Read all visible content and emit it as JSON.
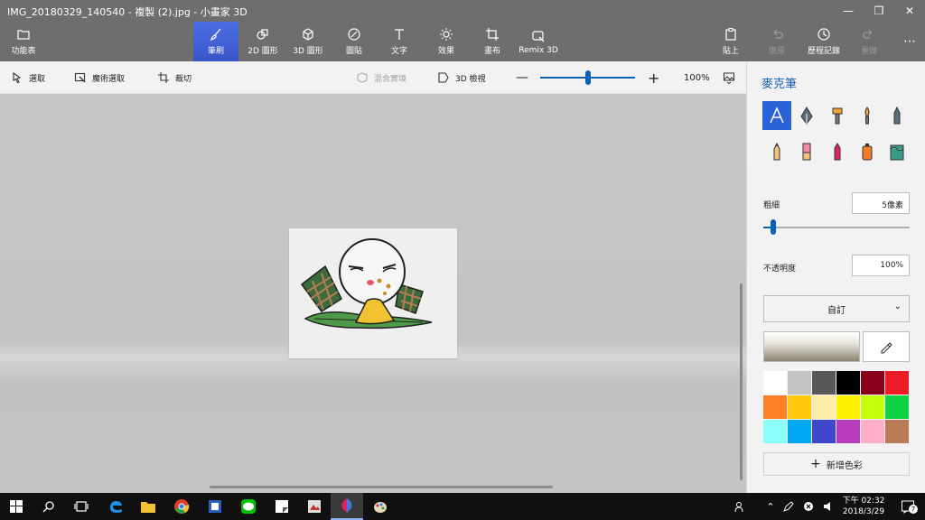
{
  "window": {
    "title": "IMG_20180329_140540 - 複製 (2).jpg - 小畫家 3D"
  },
  "ribbon": {
    "menu_label": "功能表",
    "brushes_label": "筆刷",
    "shapes2d_label": "2D 圖形",
    "shapes3d_label": "3D 圖形",
    "stickers_label": "圖貼",
    "text_label": "文字",
    "effects_label": "效果",
    "canvas_label": "畫布",
    "remix_label": "Remix 3D",
    "paste_label": "貼上",
    "undo_label": "復原",
    "history_label": "歷程記錄",
    "redo_label": "重做"
  },
  "toolbar": {
    "select_label": "選取",
    "magic_select_label": "魔術選取",
    "crop_label": "裁切",
    "mixed_reality_label": "混合實境",
    "view3d_label": "3D 檢視",
    "zoom_value": "100%",
    "zoom_fraction": 0.5
  },
  "panel": {
    "title": "麥克筆",
    "thickness_label": "粗細",
    "thickness_value": "5像素",
    "thickness_fraction": 0.05,
    "opacity_label": "不透明度",
    "opacity_value": "100%",
    "color_mode": "自訂",
    "add_color_label": "新增色彩",
    "tools": [
      "marker",
      "calligraphy-pen",
      "oil-brush",
      "watercolor",
      "pixel-pen",
      "pencil",
      "eraser",
      "crayon",
      "spray-can",
      "fill-bucket"
    ],
    "palette": [
      "#ffffff",
      "#c3c3c3",
      "#585858",
      "#000000",
      "#88001b",
      "#ec1c24",
      "#ff7f27",
      "#ffc90e",
      "#fdeca6",
      "#fff200",
      "#c4ff0e",
      "#0ed145",
      "#8cfffb",
      "#00a8f3",
      "#3f48cc",
      "#b83dba",
      "#ffaec8",
      "#b97a56"
    ]
  },
  "taskbar": {
    "time": "下午 02:32",
    "date": "2018/3/29",
    "notification_count": "7"
  }
}
